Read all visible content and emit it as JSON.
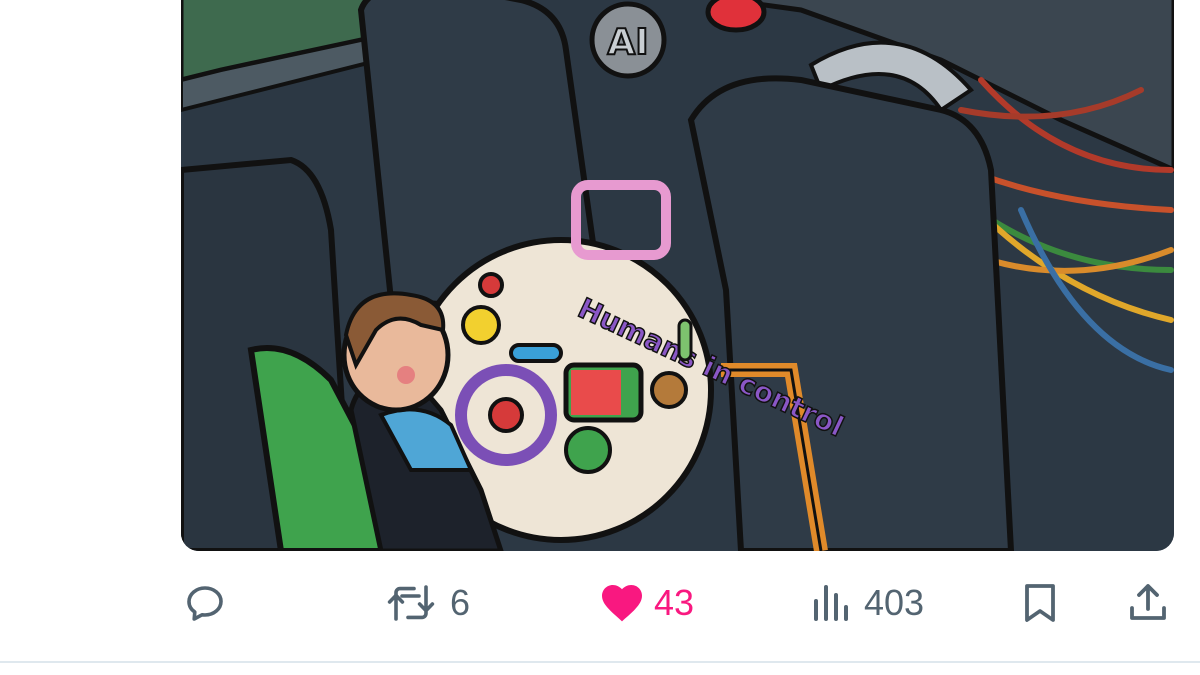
{
  "media": {
    "illustration_text": "Humans in control",
    "badge_text": "AI"
  },
  "actions": {
    "reply": {
      "icon": "reply-icon"
    },
    "repost": {
      "icon": "repost-icon",
      "count": "6"
    },
    "like": {
      "icon": "heart-icon",
      "count": "43",
      "active": true,
      "color": "#f91880"
    },
    "views": {
      "icon": "bar-chart-icon",
      "count": "403"
    },
    "bookmark": {
      "icon": "bookmark-icon"
    },
    "share": {
      "icon": "share-icon"
    }
  },
  "colors": {
    "icon_gray": "#536471",
    "like_pink": "#f91880",
    "divider": "#dfe8ee"
  }
}
